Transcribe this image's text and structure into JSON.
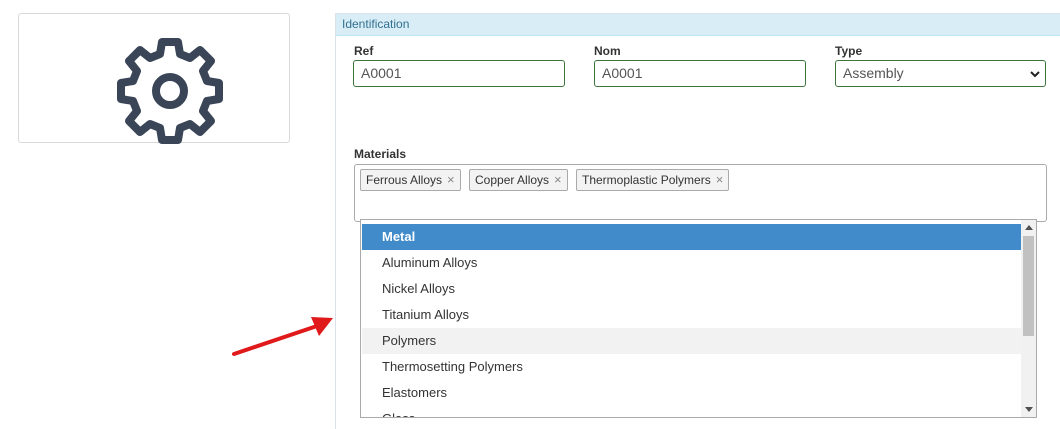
{
  "image_panel": {
    "icon": "gear-icon"
  },
  "identification": {
    "header": "Identification",
    "ref": {
      "label": "Ref",
      "value": "A0001"
    },
    "nom": {
      "label": "Nom",
      "value": "A0001"
    },
    "type": {
      "label": "Type",
      "value": "Assembly"
    }
  },
  "materials": {
    "label": "Materials",
    "tags": [
      "Ferrous Alloys",
      "Copper Alloys",
      "Thermoplastic Polymers"
    ],
    "remove_glyph": "×"
  },
  "dropdown": {
    "options": [
      "Metal",
      "Aluminum Alloys",
      "Nickel Alloys",
      "Titanium Alloys",
      "Polymers",
      "Thermosetting Polymers",
      "Elastomers",
      "Glass"
    ],
    "highlighted": "Metal",
    "hovered": "Polymers"
  },
  "colors": {
    "accent": "#428bca",
    "header_bg": "#d9edf7",
    "valid_border": "#3c763d",
    "annotation_arrow": "#e0191b",
    "icon": "#3a4657"
  }
}
